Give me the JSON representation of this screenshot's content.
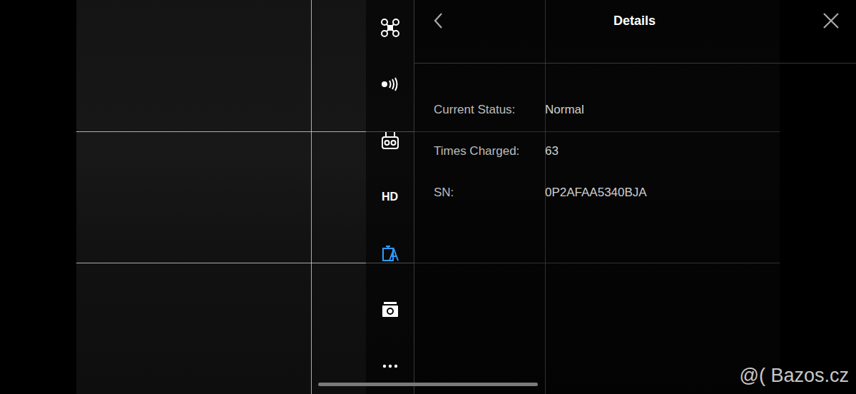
{
  "sidebar": {
    "items": [
      {
        "kind": "aircraft",
        "selected": false
      },
      {
        "kind": "signal",
        "selected": false
      },
      {
        "kind": "remote",
        "selected": false
      },
      {
        "kind": "text",
        "label": "HD",
        "selected": false
      },
      {
        "kind": "battery",
        "selected": true
      },
      {
        "kind": "camera",
        "selected": false
      },
      {
        "kind": "more",
        "selected": false
      }
    ]
  },
  "panel": {
    "title": "Details",
    "rows": [
      {
        "label": "Current Status:",
        "value": "Normal"
      },
      {
        "label": "Times Charged:",
        "value": "63"
      },
      {
        "label": "SN:",
        "value": "0P2AFAA5340BJA"
      }
    ]
  },
  "watermark": "@( Bazos.cz"
}
